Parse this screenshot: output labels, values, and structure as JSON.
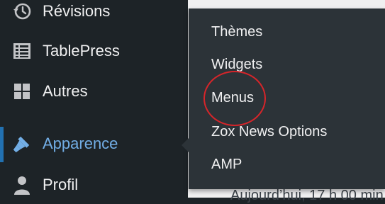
{
  "sidebar": {
    "items": [
      {
        "label": "Révisions",
        "icon": "history-icon"
      },
      {
        "label": "TablePress",
        "icon": "table-icon"
      },
      {
        "label": "Autres",
        "icon": "grid-icon"
      },
      {
        "label": "Apparence",
        "icon": "brush-icon",
        "active": true
      },
      {
        "label": "Profil",
        "icon": "user-icon"
      }
    ]
  },
  "submenu": {
    "items": [
      {
        "label": "Thèmes"
      },
      {
        "label": "Widgets"
      },
      {
        "label": "Menus",
        "highlighted": true
      },
      {
        "label": "Zox News Options"
      },
      {
        "label": "AMP"
      }
    ]
  },
  "content": {
    "date_text": "Aujourd’hui, 17 h 00 min"
  },
  "colors": {
    "sidebar_bg": "#1d2327",
    "submenu_bg": "#2c3338",
    "active_text": "#72aee6",
    "active_bar": "#2271b1",
    "annotation": "#d6252a"
  }
}
